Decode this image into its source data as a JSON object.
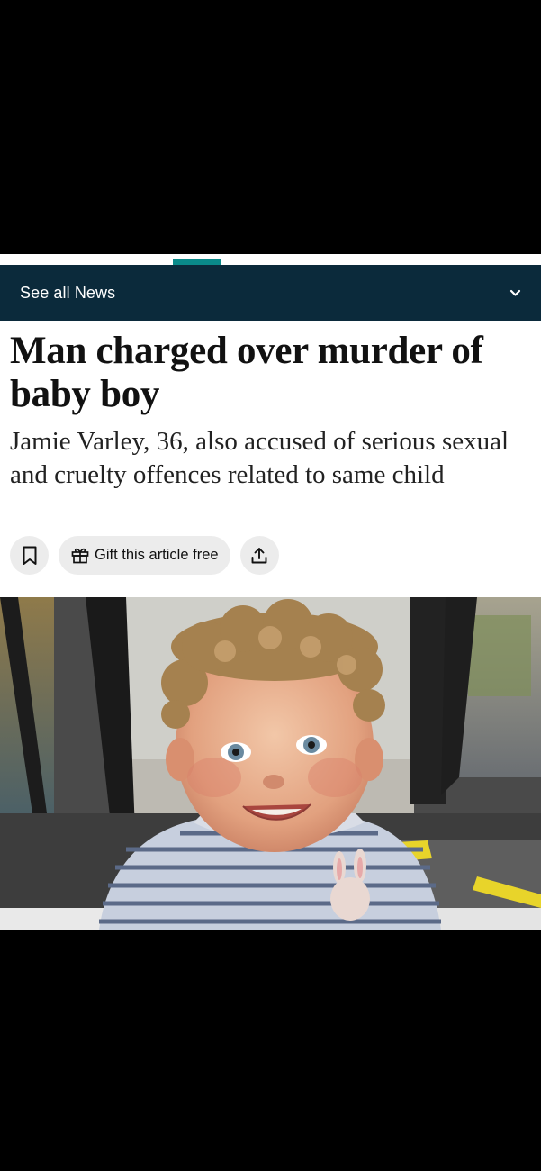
{
  "nav": {
    "label": "See all News",
    "chevron_icon": "chevron-down-icon",
    "accent_color": "#0a8a8a",
    "background_color": "#0b2a3b"
  },
  "article": {
    "headline": "Man charged over murder of baby boy",
    "standfirst": "Jamie Varley, 36, also accused of serious sexual and cruelty offences related to same child"
  },
  "actions": {
    "bookmark_icon": "bookmark-icon",
    "gift_icon": "gift-icon",
    "gift_label": "Gift this article free",
    "share_icon": "share-icon"
  },
  "photo": {
    "description_icon": "photo-of-smiling-baby"
  }
}
